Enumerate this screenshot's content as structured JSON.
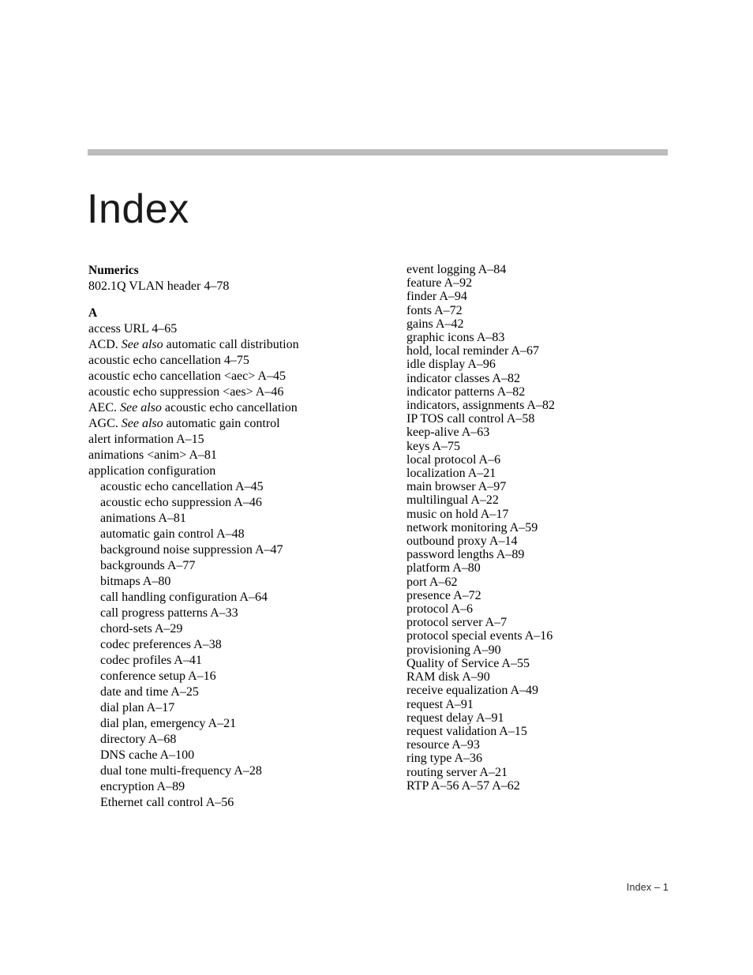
{
  "page": {
    "title": "Index",
    "folio": "Index – 1",
    "rule_color": "#bcbcbc"
  },
  "columns": {
    "left": [
      {
        "type": "letter",
        "label": "Numerics",
        "spaced": false
      },
      {
        "type": "entry",
        "label": "802.1Q VLAN header 4–78",
        "sub": false
      },
      {
        "type": "letter",
        "label": "A",
        "spaced": true
      },
      {
        "type": "entry",
        "label": "access URL 4–65",
        "sub": false
      },
      {
        "type": "entry",
        "label": "ACD.  ",
        "italic": "See also",
        "tail": " automatic call distribution",
        "sub": false
      },
      {
        "type": "entry",
        "label": "acoustic echo cancellation 4–75",
        "sub": false
      },
      {
        "type": "entry",
        "label": "acoustic echo cancellation <aec> A–45",
        "sub": false
      },
      {
        "type": "entry",
        "label": "acoustic echo suppression <aes> A–46",
        "sub": false
      },
      {
        "type": "entry",
        "label": "AEC.  ",
        "italic": "See also",
        "tail": " acoustic echo cancellation",
        "sub": false
      },
      {
        "type": "entry",
        "label": "AGC.  ",
        "italic": "See also",
        "tail": "  automatic gain control",
        "sub": false
      },
      {
        "type": "entry",
        "label": "alert information A–15",
        "sub": false
      },
      {
        "type": "entry",
        "label": "animations <anim> A–81",
        "sub": false
      },
      {
        "type": "entry",
        "label": "application configuration",
        "sub": false
      },
      {
        "type": "entry",
        "label": "acoustic echo cancellation A–45",
        "sub": true
      },
      {
        "type": "entry",
        "label": "acoustic echo suppression A–46",
        "sub": true
      },
      {
        "type": "entry",
        "label": "animations A–81",
        "sub": true
      },
      {
        "type": "entry",
        "label": "automatic gain control A–48",
        "sub": true
      },
      {
        "type": "entry",
        "label": "background noise suppression A–47",
        "sub": true
      },
      {
        "type": "entry",
        "label": "backgrounds A–77",
        "sub": true
      },
      {
        "type": "entry",
        "label": "bitmaps A–80",
        "sub": true
      },
      {
        "type": "entry",
        "label": "call handling configuration A–64",
        "sub": true
      },
      {
        "type": "entry",
        "label": "call progress patterns A–33",
        "sub": true
      },
      {
        "type": "entry",
        "label": "chord-sets A–29",
        "sub": true
      },
      {
        "type": "entry",
        "label": "codec preferences A–38",
        "sub": true
      },
      {
        "type": "entry",
        "label": "codec profiles A–41",
        "sub": true
      },
      {
        "type": "entry",
        "label": "conference setup A–16",
        "sub": true
      },
      {
        "type": "entry",
        "label": "date and time A–25",
        "sub": true
      },
      {
        "type": "entry",
        "label": "dial plan A–17",
        "sub": true
      },
      {
        "type": "entry",
        "label": "dial plan, emergency A–21",
        "sub": true
      },
      {
        "type": "entry",
        "label": "directory A–68",
        "sub": true
      },
      {
        "type": "entry",
        "label": "DNS cache A–100",
        "sub": true
      },
      {
        "type": "entry",
        "label": "dual tone multi-frequency A–28",
        "sub": true
      },
      {
        "type": "entry",
        "label": "encryption A–89",
        "sub": true
      },
      {
        "type": "entry",
        "label": "Ethernet call control A–56",
        "sub": true
      }
    ],
    "right": [
      {
        "type": "entry",
        "label": "event logging A–84",
        "sub": false
      },
      {
        "type": "entry",
        "label": "feature A–92",
        "sub": false
      },
      {
        "type": "entry",
        "label": "finder A–94",
        "sub": false
      },
      {
        "type": "entry",
        "label": "fonts A–72",
        "sub": false
      },
      {
        "type": "entry",
        "label": "gains A–42",
        "sub": false
      },
      {
        "type": "entry",
        "label": "graphic icons A–83",
        "sub": false
      },
      {
        "type": "entry",
        "label": "hold, local reminder A–67",
        "sub": false
      },
      {
        "type": "entry",
        "label": "idle display A–96",
        "sub": false
      },
      {
        "type": "entry",
        "label": "indicator classes A–82",
        "sub": false
      },
      {
        "type": "entry",
        "label": "indicator patterns A–82",
        "sub": false
      },
      {
        "type": "entry",
        "label": "indicators, assignments A–82",
        "sub": false
      },
      {
        "type": "entry",
        "label": "IP TOS call control A–58",
        "sub": false
      },
      {
        "type": "entry",
        "label": "keep-alive A–63",
        "sub": false
      },
      {
        "type": "entry",
        "label": "keys A–75",
        "sub": false
      },
      {
        "type": "entry",
        "label": "local protocol A–6",
        "sub": false
      },
      {
        "type": "entry",
        "label": "localization A–21",
        "sub": false
      },
      {
        "type": "entry",
        "label": "main browser A–97",
        "sub": false
      },
      {
        "type": "entry",
        "label": "multilingual A–22",
        "sub": false
      },
      {
        "type": "entry",
        "label": "music on hold A–17",
        "sub": false
      },
      {
        "type": "entry",
        "label": "network monitoring A–59",
        "sub": false
      },
      {
        "type": "entry",
        "label": "outbound proxy A–14",
        "sub": false
      },
      {
        "type": "entry",
        "label": "password lengths A–89",
        "sub": false
      },
      {
        "type": "entry",
        "label": "platform A–80",
        "sub": false
      },
      {
        "type": "entry",
        "label": "port A–62",
        "sub": false
      },
      {
        "type": "entry",
        "label": "presence A–72",
        "sub": false
      },
      {
        "type": "entry",
        "label": "protocol A–6",
        "sub": false
      },
      {
        "type": "entry",
        "label": "protocol server A–7",
        "sub": false
      },
      {
        "type": "entry",
        "label": "protocol special events A–16",
        "sub": false
      },
      {
        "type": "entry",
        "label": "provisioning A–90",
        "sub": false
      },
      {
        "type": "entry",
        "label": "Quality of Service A–55",
        "sub": false
      },
      {
        "type": "entry",
        "label": "RAM disk A–90",
        "sub": false
      },
      {
        "type": "entry",
        "label": "receive equalization A–49",
        "sub": false
      },
      {
        "type": "entry",
        "label": "request A–91",
        "sub": false
      },
      {
        "type": "entry",
        "label": "request delay A–91",
        "sub": false
      },
      {
        "type": "entry",
        "label": "request validation A–15",
        "sub": false
      },
      {
        "type": "entry",
        "label": "resource A–93",
        "sub": false
      },
      {
        "type": "entry",
        "label": "ring type A–36",
        "sub": false
      },
      {
        "type": "entry",
        "label": "routing server A–21",
        "sub": false
      },
      {
        "type": "entry",
        "label": "RTP A–56  A–57  A–62",
        "sub": false
      }
    ]
  }
}
